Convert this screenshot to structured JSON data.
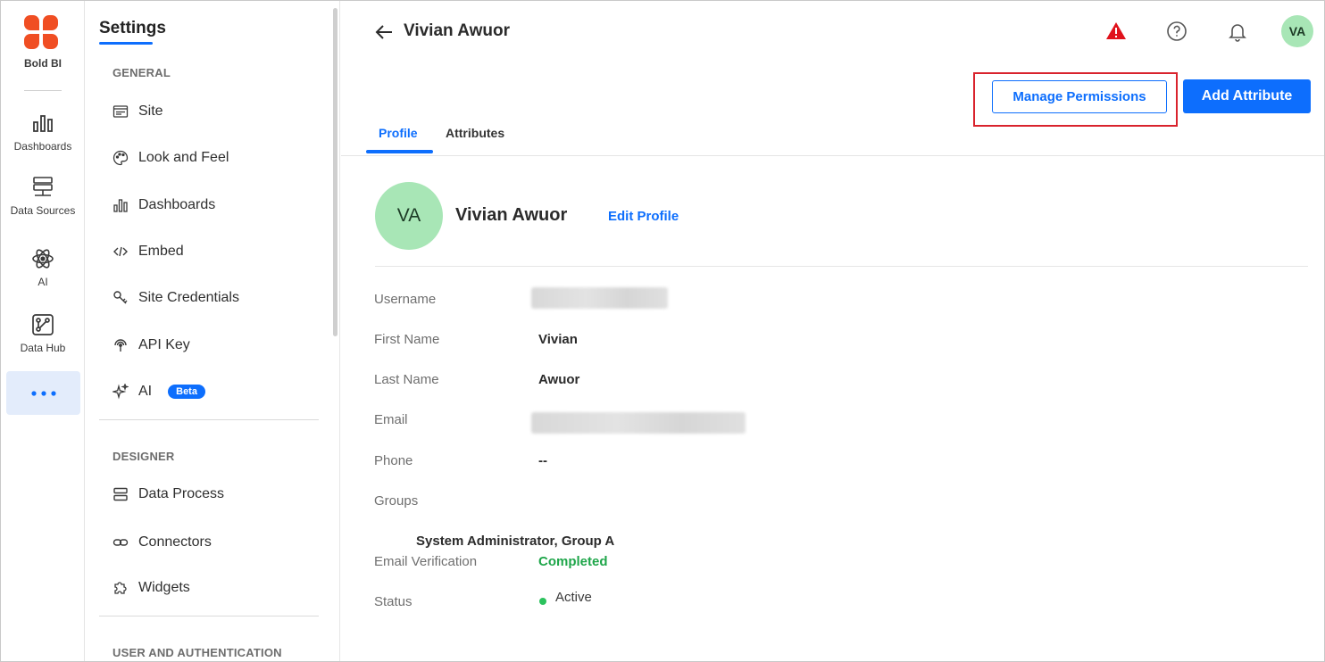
{
  "app": {
    "name": "Bold BI"
  },
  "rail": {
    "items": [
      {
        "label": "Dashboards",
        "icon": "bar-chart-icon"
      },
      {
        "label": "Data Sources",
        "icon": "database-icon"
      },
      {
        "label": "AI",
        "icon": "atom-icon"
      },
      {
        "label": "Data Hub",
        "icon": "data-hub-icon"
      }
    ],
    "more_icon": "more-horizontal-icon"
  },
  "settings": {
    "title": "Settings",
    "general": {
      "heading": "GENERAL",
      "items": [
        {
          "label": "Site",
          "icon": "url-icon"
        },
        {
          "label": "Look and Feel",
          "icon": "palette-icon"
        },
        {
          "label": "Dashboards",
          "icon": "bar-chart-icon"
        },
        {
          "label": "Embed",
          "icon": "code-icon"
        },
        {
          "label": "Site Credentials",
          "icon": "key-icon"
        },
        {
          "label": "API Key",
          "icon": "api-key-icon"
        },
        {
          "label": "AI",
          "icon": "sparkle-icon",
          "badge": "Beta"
        }
      ]
    },
    "designer": {
      "heading": "DESIGNER",
      "items": [
        {
          "label": "Data Process",
          "icon": "data-process-icon"
        },
        {
          "label": "Connectors",
          "icon": "link-icon"
        },
        {
          "label": "Widgets",
          "icon": "puzzle-icon"
        }
      ]
    },
    "user_auth": {
      "heading": "USER AND AUTHENTICATION"
    }
  },
  "header": {
    "title": "Vivian Awuor",
    "avatar_initials": "VA",
    "warning_color": "#e0121b"
  },
  "actions": {
    "manage_permissions": "Manage Permissions",
    "add_attribute": "Add Attribute"
  },
  "tabs": [
    {
      "label": "Profile",
      "active": true
    },
    {
      "label": "Attributes",
      "active": false
    }
  ],
  "profile": {
    "initials": "VA",
    "name": "Vivian Awuor",
    "edit_label": "Edit Profile",
    "fields": {
      "username_label": "Username",
      "first_name_label": "First Name",
      "first_name": "Vivian",
      "last_name_label": "Last Name",
      "last_name": "Awuor",
      "email_label": "Email",
      "phone_label": "Phone",
      "phone": "--",
      "groups_label": "Groups",
      "groups": "System Administrator, Group A",
      "email_verification_label": "Email Verification",
      "email_verification": "Completed",
      "status_label": "Status",
      "status": "Active"
    }
  },
  "colors": {
    "accent": "#0d6efd",
    "brand_orange": "#f04e23",
    "success": "#1fa64a",
    "highlight_box": "#d9232d",
    "avatar_bg": "#a8e6b6"
  }
}
